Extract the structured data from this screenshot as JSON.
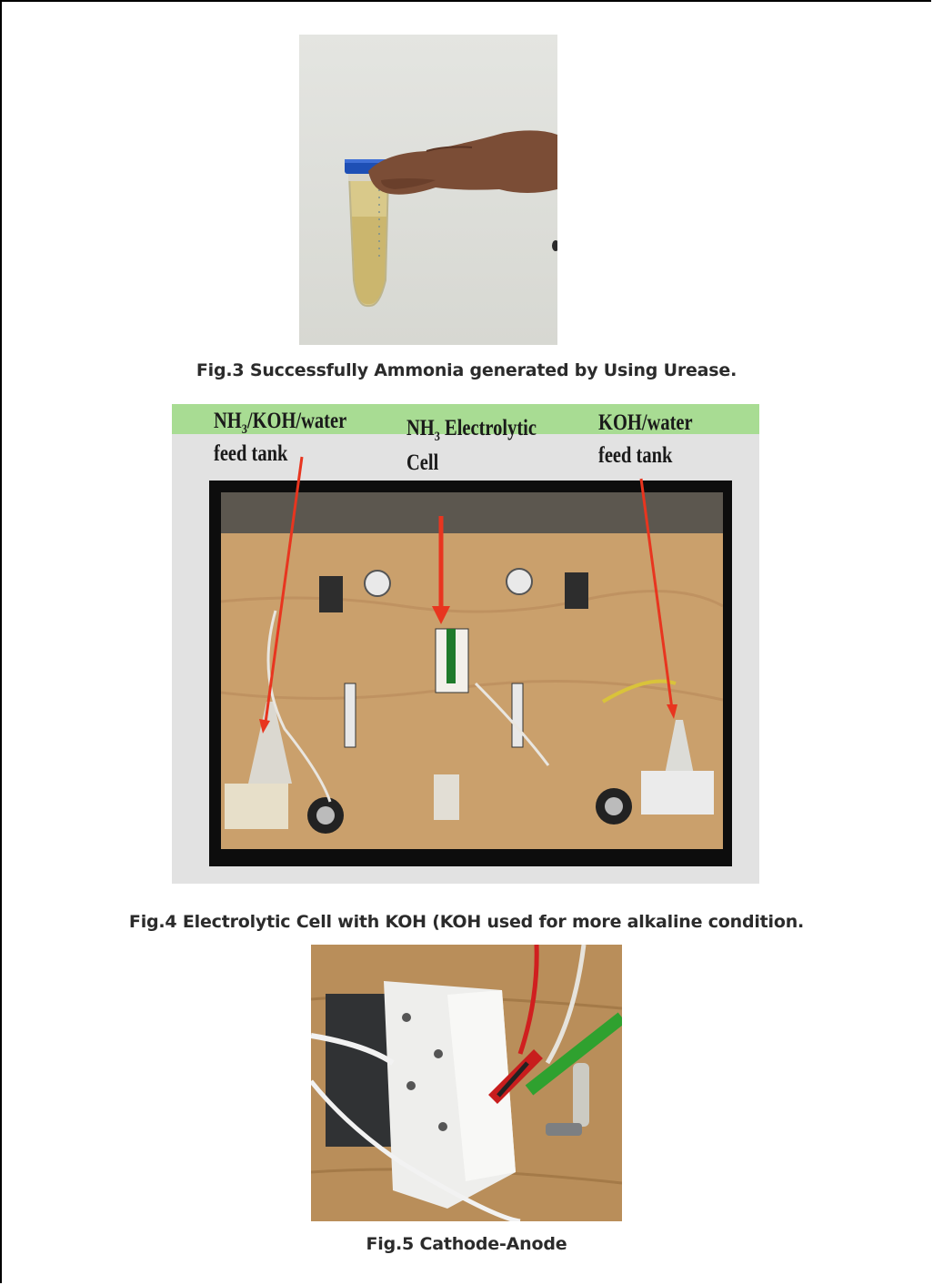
{
  "figures": [
    {
      "id": "fig3",
      "caption": "Fig.3 Successfully Ammonia generated by Using Urease."
    },
    {
      "id": "fig4",
      "caption": "Fig.4 Electrolytic Cell with KOH (KOH used for more alkaline condition.",
      "labels": {
        "left_line1": "NH",
        "left_sub": "3",
        "left_line1_rest": "/KOH/water",
        "left_line2": "feed tank",
        "center_line1": "NH",
        "center_sub": "3",
        "center_line1_rest": " Electrolytic",
        "center_line2": "Cell",
        "right_line1": "KOH/water",
        "right_line2": "feed tank"
      }
    },
    {
      "id": "fig5",
      "caption": "Fig.5 Cathode-Anode"
    }
  ],
  "colors": {
    "banner_green": "#a8dc93",
    "arrow_red": "#e8351f",
    "caption_text": "#2b2b2b"
  }
}
